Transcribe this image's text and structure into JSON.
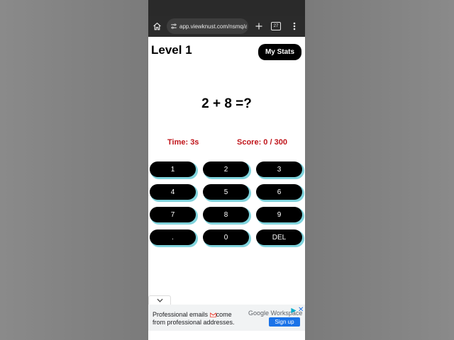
{
  "browser": {
    "url": "app.viewknust.com/nsmq/ad",
    "tab_count": "27",
    "icons": [
      "home-icon",
      "site-settings-icon",
      "plus-icon",
      "tabs-icon",
      "menu-icon"
    ]
  },
  "game": {
    "level": "Level 1",
    "stats_label": "My Stats",
    "question": "2 + 8 =?",
    "timer": "Time: 3s",
    "score": "Score: 0 / 300",
    "keys": [
      "1",
      "2",
      "3",
      "4",
      "5",
      "6",
      "7",
      "8",
      "9",
      ".",
      "0",
      "DEL"
    ]
  },
  "ad": {
    "line1_before": "Professional emails",
    "line1_after": "come",
    "line2": "from professional addresses.",
    "brand": "Google Workspace",
    "cta": "Sign up",
    "close": "✕"
  },
  "colors": {
    "accent_red": "#c0141a",
    "key_bg": "#000000",
    "key_glow": "#7fd3dc",
    "ad_button": "#1a73e8"
  }
}
